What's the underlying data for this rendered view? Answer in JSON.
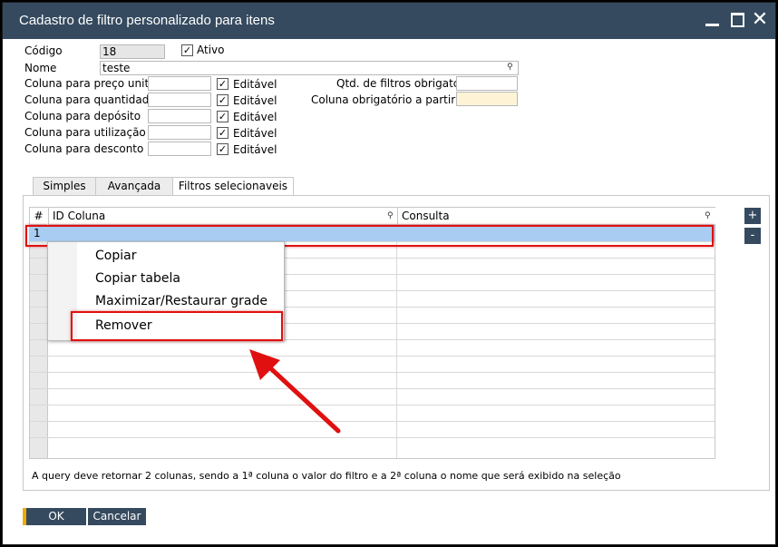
{
  "window": {
    "title": "Cadastro de filtro personalizado para itens"
  },
  "form": {
    "codigo_label": "Código",
    "codigo_value": "18",
    "ativo_label": "Ativo",
    "nome_label": "Nome",
    "nome_value": "teste",
    "rows": [
      {
        "label": "Coluna para preço unit",
        "editavel": "Editável"
      },
      {
        "label": "Coluna para quantidade",
        "editavel": "Editável"
      },
      {
        "label": "Coluna para depósito",
        "editavel": "Editável"
      },
      {
        "label": "Coluna para utilização",
        "editavel": "Editável"
      },
      {
        "label": "Coluna para desconto",
        "editavel": "Editável"
      }
    ],
    "qtd_label": "Qtd. de filtros obrigatc",
    "coluna_obrig_label": "Coluna obrigatório a partir dc"
  },
  "tabs": [
    {
      "label": "Simples"
    },
    {
      "label": "Avançada"
    },
    {
      "label": "Filtros selecionaveis"
    }
  ],
  "grid": {
    "columns": [
      "#",
      "ID Coluna",
      "Consulta"
    ],
    "row_number": "1"
  },
  "side_buttons": {
    "add": "+",
    "remove": "-"
  },
  "context_menu": {
    "items": [
      "Copiar",
      "Copiar tabela",
      "Maximizar/Restaurar grade",
      "Remover"
    ]
  },
  "note": "A query deve retornar 2 colunas, sendo a 1ª coluna o valor do filtro e a 2ª coluna o nome que será exibido na seleção",
  "footer": {
    "ok": "OK",
    "cancel": "Cancelar"
  },
  "colors": {
    "titlebar": "#354a5f",
    "highlight": "#e01010",
    "selection": "#a9cdf2",
    "ok_accent": "#f0ab00"
  }
}
